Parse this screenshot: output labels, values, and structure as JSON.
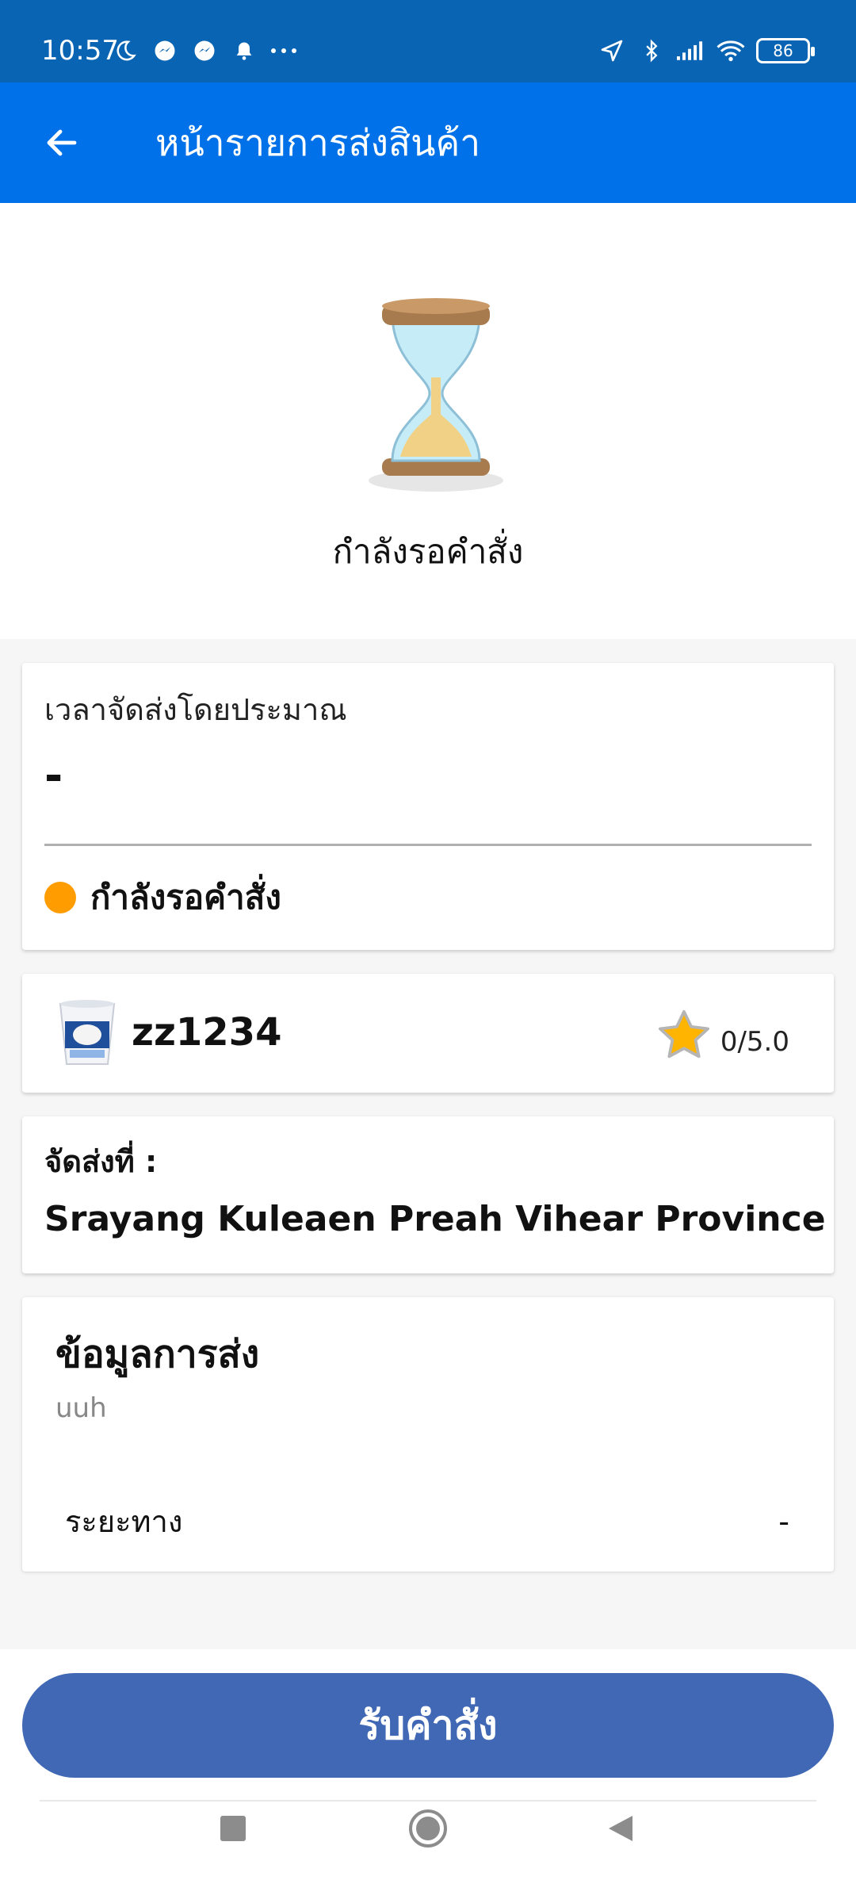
{
  "status_bar": {
    "time": "10:57",
    "battery": "86",
    "icons_left": [
      "moon-icon",
      "messenger-icon",
      "messenger-icon",
      "bell-icon",
      "more-dots-icon"
    ],
    "icons_right": [
      "location-arrow-icon",
      "bluetooth-icon",
      "signal-icon",
      "wifi-icon",
      "battery-icon"
    ]
  },
  "appbar": {
    "title": "หน้ารายการส่งสินค้า",
    "back_icon": "arrow-left-icon"
  },
  "hero": {
    "icon": "hourglass-icon",
    "status_text": "กำลังรอคำสั่ง"
  },
  "eta_card": {
    "label": "เวลาจัดส่งโดยประมาณ",
    "value": "-",
    "status_label": "กำลังรอคำสั่ง",
    "status_color": "#ff9d00"
  },
  "store_card": {
    "name": "zz1234",
    "rating": "0/5.0"
  },
  "destination_card": {
    "label": "จัดส่งที่ :",
    "address": "Srayang Kuleaen Preah Vihear Province"
  },
  "delivery_info": {
    "heading": "ข้อมูลการส่ง",
    "sub": "uuh",
    "distance_label": "ระยะทาง",
    "distance_value": "-"
  },
  "footer": {
    "accept_label": "รับคำสั่ง",
    "accent_color": "#4068b4"
  },
  "navbar": {
    "icons": [
      "recent-apps-icon",
      "home-icon",
      "back-icon"
    ]
  }
}
